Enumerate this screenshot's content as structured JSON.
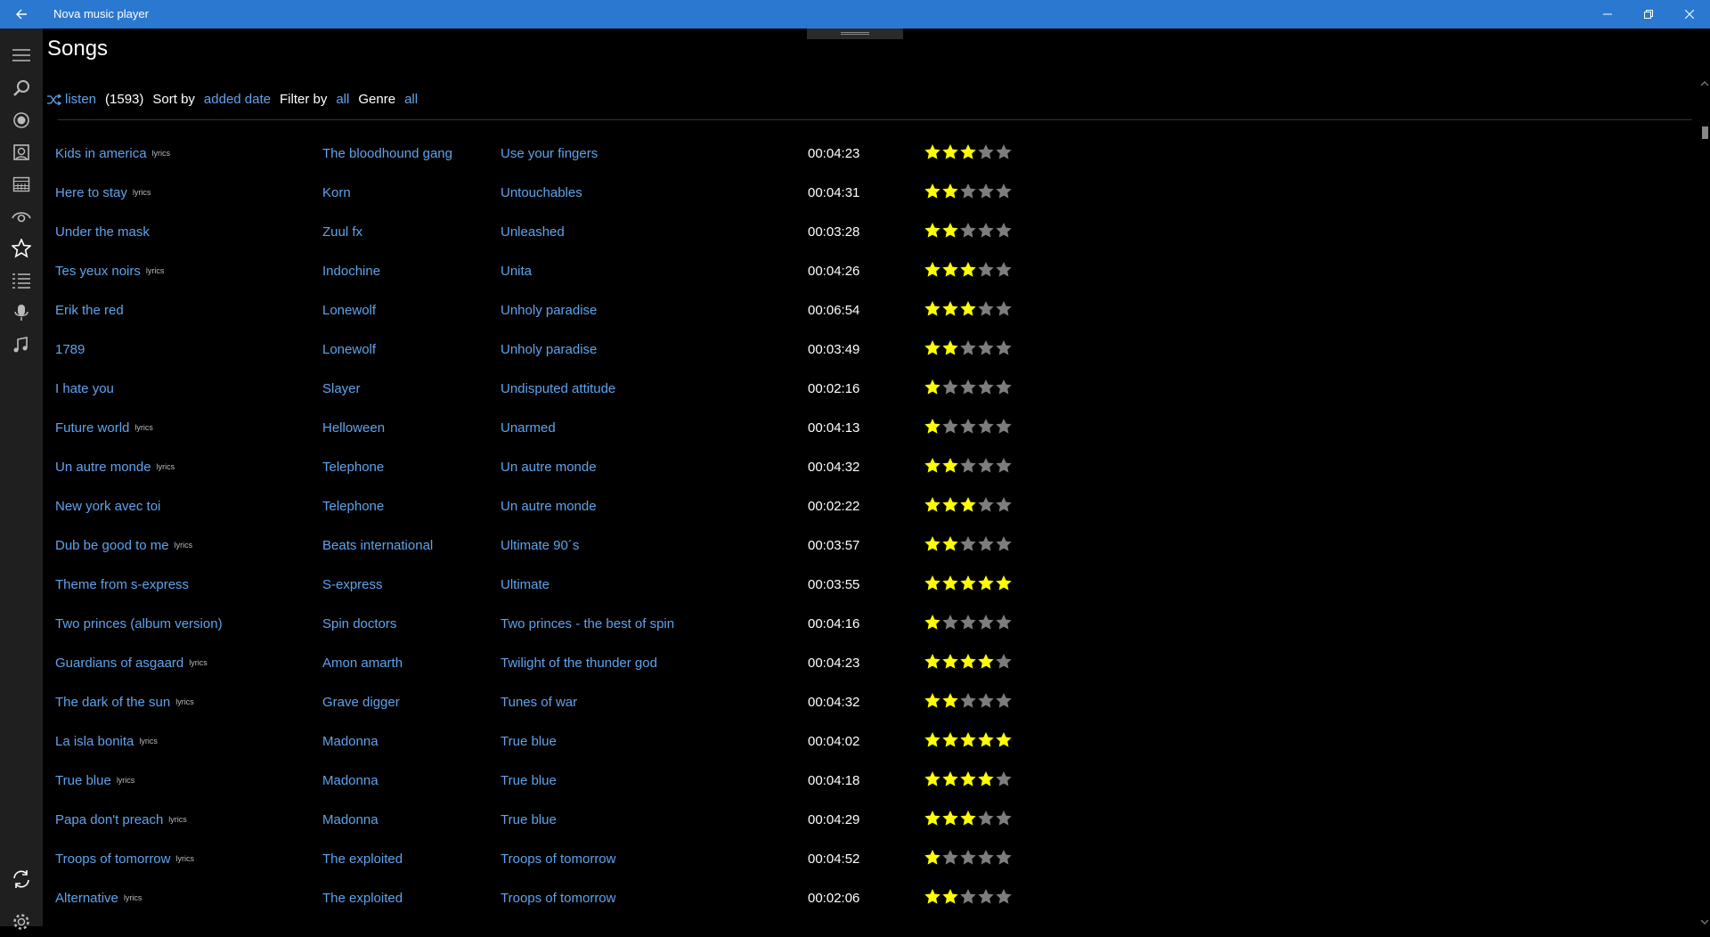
{
  "app": {
    "title": "Nova music player"
  },
  "header": {
    "page_title": "Songs",
    "listen_label": "listen",
    "count": "(1593)",
    "sort_label": "Sort by",
    "sort_value": "added date",
    "filter_label": "Filter by",
    "filter_value": "all",
    "genre_label": "Genre",
    "genre_value": "all"
  },
  "colors": {
    "accent": "#2b78d0",
    "link": "#5fa3ec",
    "star_on": "#ffff00",
    "star_off": "#7d7d7d"
  },
  "sidebar_icons": [
    "menu-icon",
    "search-icon",
    "radio-icon",
    "albums-icon",
    "calendar-icon",
    "eye-icon",
    "star-icon",
    "list-icon",
    "microphone-icon",
    "music-notes-icon",
    "sync-icon",
    "settings-icon"
  ],
  "lyrics_tag": "lyrics",
  "songs": [
    {
      "title": "Kids in america",
      "lyrics": true,
      "artist": "The bloodhound gang",
      "album": "Use your fingers",
      "duration": "00:04:23",
      "rating": 3
    },
    {
      "title": "Here to stay",
      "lyrics": true,
      "artist": "Korn",
      "album": "Untouchables",
      "duration": "00:04:31",
      "rating": 2
    },
    {
      "title": "Under the mask",
      "lyrics": false,
      "artist": "Zuul fx",
      "album": "Unleashed",
      "duration": "00:03:28",
      "rating": 2
    },
    {
      "title": "Tes yeux noirs",
      "lyrics": true,
      "artist": "Indochine",
      "album": "Unita",
      "duration": "00:04:26",
      "rating": 3
    },
    {
      "title": "Erik the red",
      "lyrics": false,
      "artist": "Lonewolf",
      "album": "Unholy paradise",
      "duration": "00:06:54",
      "rating": 3
    },
    {
      "title": "1789",
      "lyrics": false,
      "artist": "Lonewolf",
      "album": "Unholy paradise",
      "duration": "00:03:49",
      "rating": 2
    },
    {
      "title": "I hate you",
      "lyrics": false,
      "artist": "Slayer",
      "album": "Undisputed attitude",
      "duration": "00:02:16",
      "rating": 1
    },
    {
      "title": "Future world",
      "lyrics": true,
      "artist": "Helloween",
      "album": "Unarmed",
      "duration": "00:04:13",
      "rating": 1
    },
    {
      "title": "Un autre monde",
      "lyrics": true,
      "artist": "Telephone",
      "album": "Un autre monde",
      "duration": "00:04:32",
      "rating": 2
    },
    {
      "title": "New york avec toi",
      "lyrics": false,
      "artist": "Telephone",
      "album": "Un autre monde",
      "duration": "00:02:22",
      "rating": 3
    },
    {
      "title": "Dub be good to me",
      "lyrics": true,
      "artist": "Beats international",
      "album": "Ultimate 90´s",
      "duration": "00:03:57",
      "rating": 2
    },
    {
      "title": "Theme from s-express",
      "lyrics": false,
      "artist": "S-express",
      "album": "Ultimate",
      "duration": "00:03:55",
      "rating": 5
    },
    {
      "title": "Two princes (album version)",
      "lyrics": false,
      "artist": "Spin doctors",
      "album": "Two princes - the best of spin",
      "duration": "00:04:16",
      "rating": 1
    },
    {
      "title": "Guardians of asgaard",
      "lyrics": true,
      "artist": "Amon amarth",
      "album": "Twilight of the thunder god",
      "duration": "00:04:23",
      "rating": 4
    },
    {
      "title": "The dark of the sun",
      "lyrics": true,
      "artist": "Grave digger",
      "album": "Tunes of war",
      "duration": "00:04:32",
      "rating": 2
    },
    {
      "title": "La isla bonita",
      "lyrics": true,
      "artist": "Madonna",
      "album": "True blue",
      "duration": "00:04:02",
      "rating": 5
    },
    {
      "title": "True blue",
      "lyrics": true,
      "artist": "Madonna",
      "album": "True blue",
      "duration": "00:04:18",
      "rating": 4
    },
    {
      "title": "Papa don't preach",
      "lyrics": true,
      "artist": "Madonna",
      "album": "True blue",
      "duration": "00:04:29",
      "rating": 3
    },
    {
      "title": "Troops of tomorrow",
      "lyrics": true,
      "artist": "The exploited",
      "album": "Troops of tomorrow",
      "duration": "00:04:52",
      "rating": 1
    },
    {
      "title": "Alternative",
      "lyrics": true,
      "artist": "The exploited",
      "album": "Troops of tomorrow",
      "duration": "00:02:06",
      "rating": 2
    }
  ]
}
